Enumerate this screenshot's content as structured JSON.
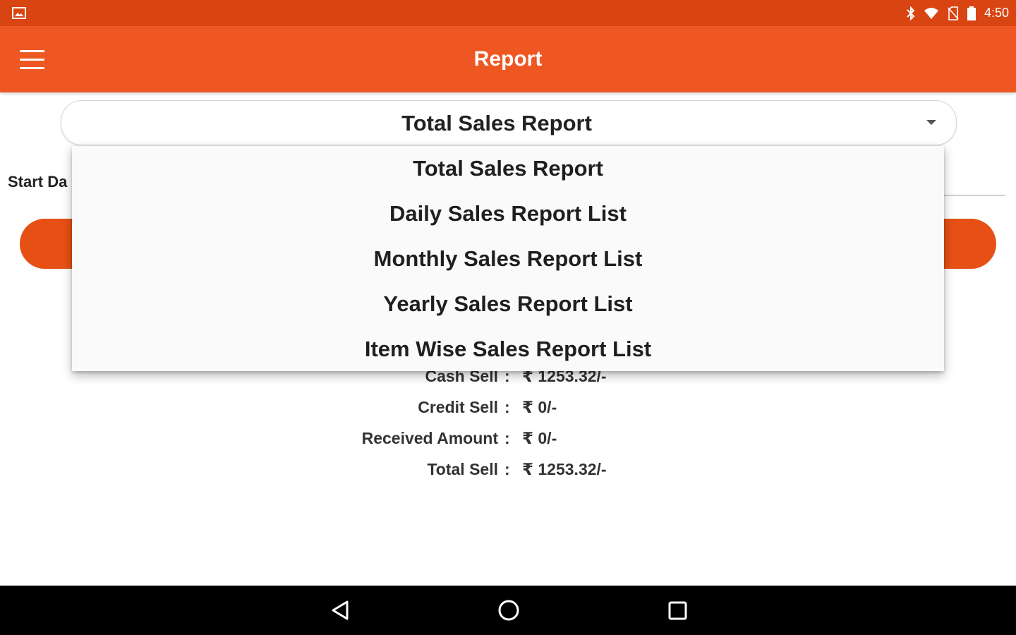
{
  "status_bar": {
    "time": "4:50",
    "icons": [
      "gallery-icon",
      "bluetooth-icon",
      "wifi-icon",
      "no-sim-icon",
      "battery-icon"
    ]
  },
  "app_bar": {
    "title": "Report",
    "menu_icon": "hamburger-menu-icon"
  },
  "spinner": {
    "selected": "Total Sales Report"
  },
  "dropdown": {
    "options": [
      "Total Sales Report",
      "Daily Sales Report List",
      "Monthly Sales Report List",
      "Yearly Sales Report List",
      "Item Wise Sales Report List"
    ]
  },
  "form": {
    "start_date_label": "Start Da"
  },
  "summary": {
    "rows": [
      {
        "label": "Cash Sell",
        "colon": ":",
        "value": "₹ 1253.32/-"
      },
      {
        "label": "Credit Sell",
        "colon": ":",
        "value": "₹ 0/-"
      },
      {
        "label": "Received Amount",
        "colon": ":",
        "value": "₹ 0/-"
      },
      {
        "label": "Total Sell",
        "colon": ":",
        "value": "₹ 1253.32/-"
      }
    ]
  },
  "nav_bar": {
    "icons": [
      "back-icon",
      "home-icon",
      "recents-icon"
    ]
  },
  "colors": {
    "status_bar": "#d94413",
    "app_bar": "#ef5722",
    "accent_button": "#e65015"
  }
}
